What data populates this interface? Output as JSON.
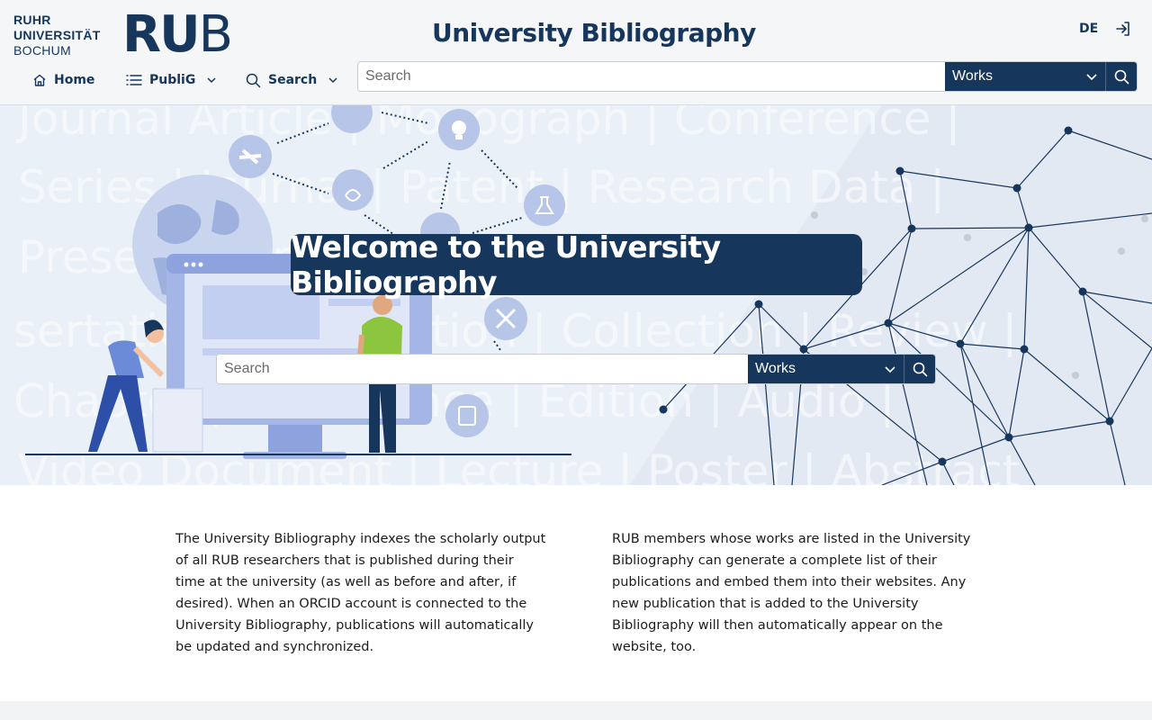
{
  "header": {
    "logo": {
      "line1": "RUHR",
      "line2": "UNIVERSITÄT",
      "line3": "BOCHUM",
      "big_ru": "RU",
      "big_b": "B"
    },
    "site_title": "University Bibliography",
    "language": "DE",
    "nav": [
      {
        "label": "Home",
        "icon": "home-icon"
      },
      {
        "label": "PubliG",
        "icon": "list-icon"
      },
      {
        "label": "Search",
        "icon": "search-icon"
      }
    ],
    "search": {
      "placeholder": "Search",
      "value": "",
      "type_selected": "Works"
    }
  },
  "hero": {
    "title": "Welcome to the University Bibliography",
    "background_words": [
      "Journal Article | Monograph | Conference |",
      "Series | Journal | Patent | Research Data |",
      "Presentation | Report | Dis-",
      "sertation | Habilitation | Collection | Review |",
      "Chapter | Conference | Edition | Audio |",
      "Video Document | Lecture | Poster | Abstract"
    ],
    "search": {
      "placeholder": "Search",
      "value": "",
      "type_selected": "Works"
    }
  },
  "intro": {
    "left": "The University Bibliography indexes the scholarly output of all RUB researchers that is published during their time at the university (as well as before and after, if desired). When an ORCID account is connected to the University Bibliography, publications will automatically be updated and synchronized.",
    "right": "RUB members whose works are listed in the University Bibliography can generate a complete list of their publications and embed them into their websites. Any new publication that is added to the University Bibliography will then automatically appear on the website, too."
  },
  "colors": {
    "brand": "#17365c",
    "hero_bg": "#eaf0f7",
    "illustration": "#7f98d6"
  }
}
